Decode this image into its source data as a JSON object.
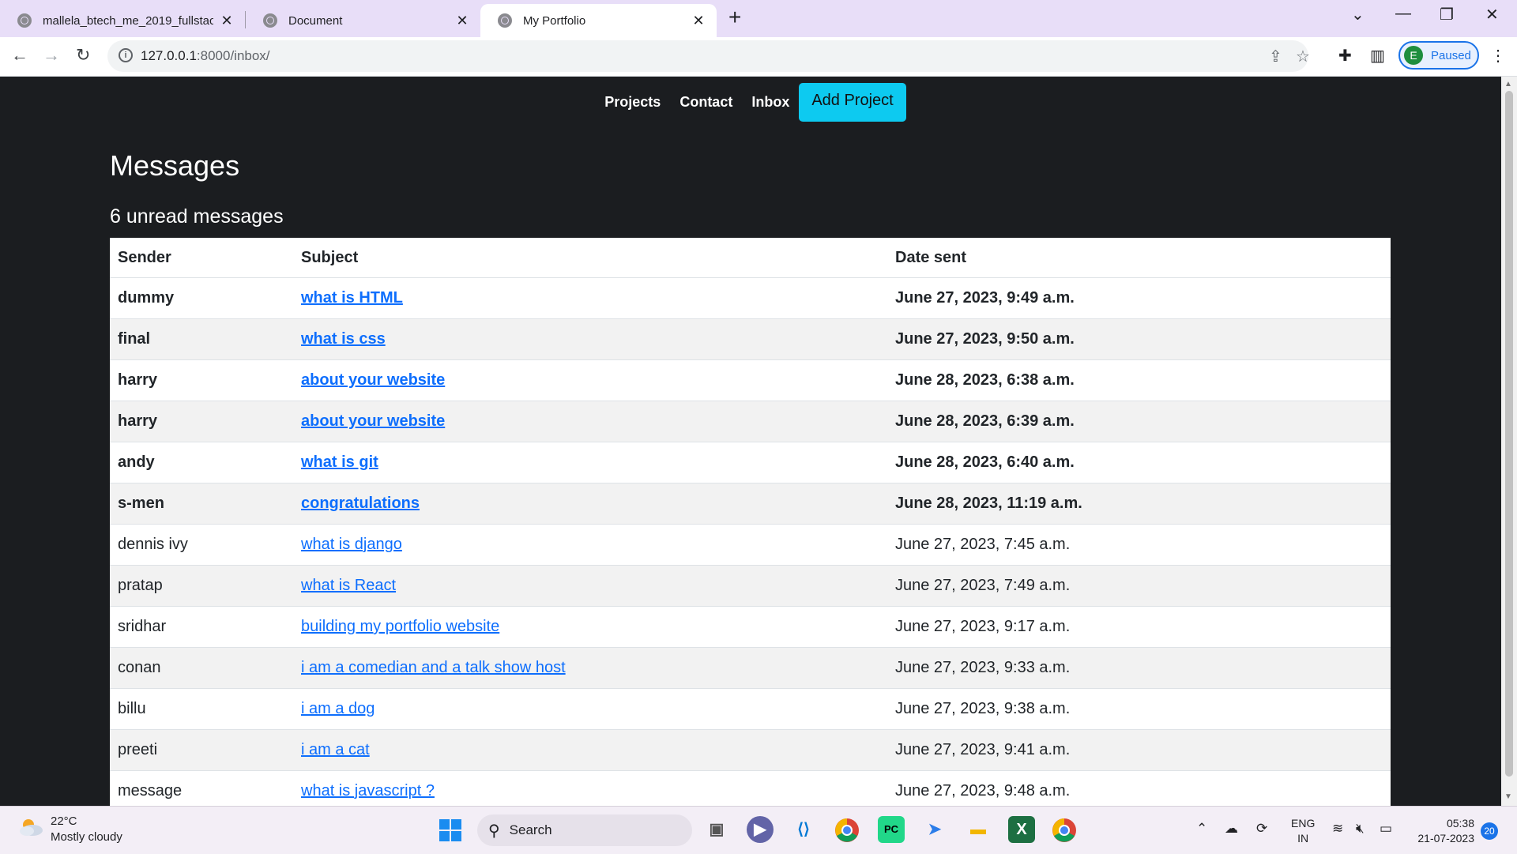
{
  "browser": {
    "tabs": [
      {
        "title": "mallela_btech_me_2019_fullstack",
        "active": false
      },
      {
        "title": "Document",
        "active": false
      },
      {
        "title": "My Portfolio",
        "active": true
      }
    ],
    "url_host": "127.0.0.1",
    "url_path": ":8000/inbox/",
    "profile_initial": "E",
    "profile_status": "Paused"
  },
  "site": {
    "nav": {
      "projects": "Projects",
      "contact": "Contact",
      "inbox": "Inbox",
      "add_project": "Add Project"
    },
    "heading": "Messages",
    "unread_summary": "6 unread messages",
    "table": {
      "headers": {
        "sender": "Sender",
        "subject": "Subject",
        "date": "Date sent"
      },
      "rows": [
        {
          "sender": "dummy",
          "subject": "what is HTML",
          "date": "June 27, 2023, 9:49 a.m."
        },
        {
          "sender": "final",
          "subject": "what is css",
          "date": "June 27, 2023, 9:50 a.m."
        },
        {
          "sender": "harry",
          "subject": "about your website",
          "date": "June 28, 2023, 6:38 a.m."
        },
        {
          "sender": "harry",
          "subject": "about your website",
          "date": "June 28, 2023, 6:39 a.m."
        },
        {
          "sender": "andy",
          "subject": "what is git",
          "date": "June 28, 2023, 6:40 a.m."
        },
        {
          "sender": "s-men",
          "subject": "congratulations",
          "date": "June 28, 2023, 11:19 a.m."
        },
        {
          "sender": "dennis ivy",
          "subject": "what is django",
          "date": "June 27, 2023, 7:45 a.m."
        },
        {
          "sender": "pratap",
          "subject": "what is React",
          "date": "June 27, 2023, 7:49 a.m."
        },
        {
          "sender": "sridhar",
          "subject": "building my portfolio website",
          "date": "June 27, 2023, 9:17 a.m."
        },
        {
          "sender": "conan",
          "subject": "i am a comedian and a talk show host",
          "date": "June 27, 2023, 9:33 a.m."
        },
        {
          "sender": "billu",
          "subject": "i am a dog",
          "date": "June 27, 2023, 9:38 a.m."
        },
        {
          "sender": "preeti",
          "subject": "i am a cat",
          "date": "June 27, 2023, 9:41 a.m."
        },
        {
          "sender": "message",
          "subject": "what is javascript ?",
          "date": "June 27, 2023, 9:48 a.m."
        }
      ]
    }
  },
  "taskbar": {
    "temperature": "22°C",
    "weather": "Mostly cloudy",
    "search_label": "Search",
    "lang_top": "ENG",
    "lang_bottom": "IN",
    "time": "05:38",
    "date": "21-07-2023",
    "notification_count": "20"
  }
}
